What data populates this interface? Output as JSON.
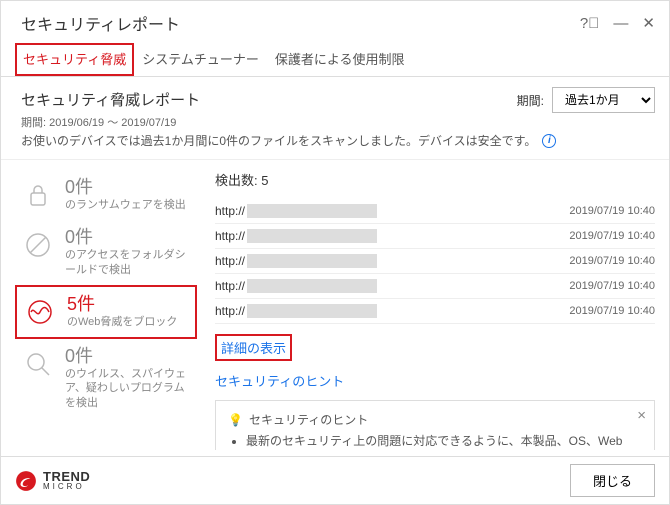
{
  "window": {
    "title": "セキュリティレポート"
  },
  "tabs": [
    {
      "label": "セキュリティ脅威",
      "active": true
    },
    {
      "label": "システムチューナー",
      "active": false
    },
    {
      "label": "保護者による使用制限",
      "active": false
    }
  ],
  "report": {
    "title": "セキュリティ脅威レポート",
    "range_label": "期間: 2019/06/19 ～ 2019/07/19",
    "desc": "お使いのデバイスでは過去1か月間に0件のファイルをスキャンしました。デバイスは安全です。",
    "period_label": "期間:",
    "period_value": "過去1か月"
  },
  "sidebar": [
    {
      "count": "0件",
      "desc": "のランサムウェアを検出",
      "icon": "lock"
    },
    {
      "count": "0件",
      "desc": "のアクセスをフォルダシールドで検出",
      "icon": "block"
    },
    {
      "count": "5件",
      "desc": "のWeb脅威をブロック",
      "icon": "wave",
      "active": true
    },
    {
      "count": "0件",
      "desc": "のウイルス、スパイウェア、疑わしいプログラムを検出",
      "icon": "search"
    }
  ],
  "detections": {
    "title": "検出数: 5",
    "rows": [
      {
        "url": "http://",
        "ts": "2019/07/19 10:40"
      },
      {
        "url": "http://",
        "ts": "2019/07/19 10:40"
      },
      {
        "url": "http://",
        "ts": "2019/07/19 10:40"
      },
      {
        "url": "http://",
        "ts": "2019/07/19 10:40"
      },
      {
        "url": "http://",
        "ts": "2019/07/19 10:40"
      }
    ],
    "show_detail": "詳細の表示",
    "hint_link": "セキュリティのヒント"
  },
  "hint_box": {
    "title": "セキュリティのヒント",
    "body": "最新のセキュリティ上の問題に対応できるように、本製品、OS、Webブラウザ、PDFリーダーなどのアプリケー"
  },
  "brand": {
    "name": "TREND",
    "sub": "MICRO"
  },
  "buttons": {
    "close": "閉じる"
  }
}
